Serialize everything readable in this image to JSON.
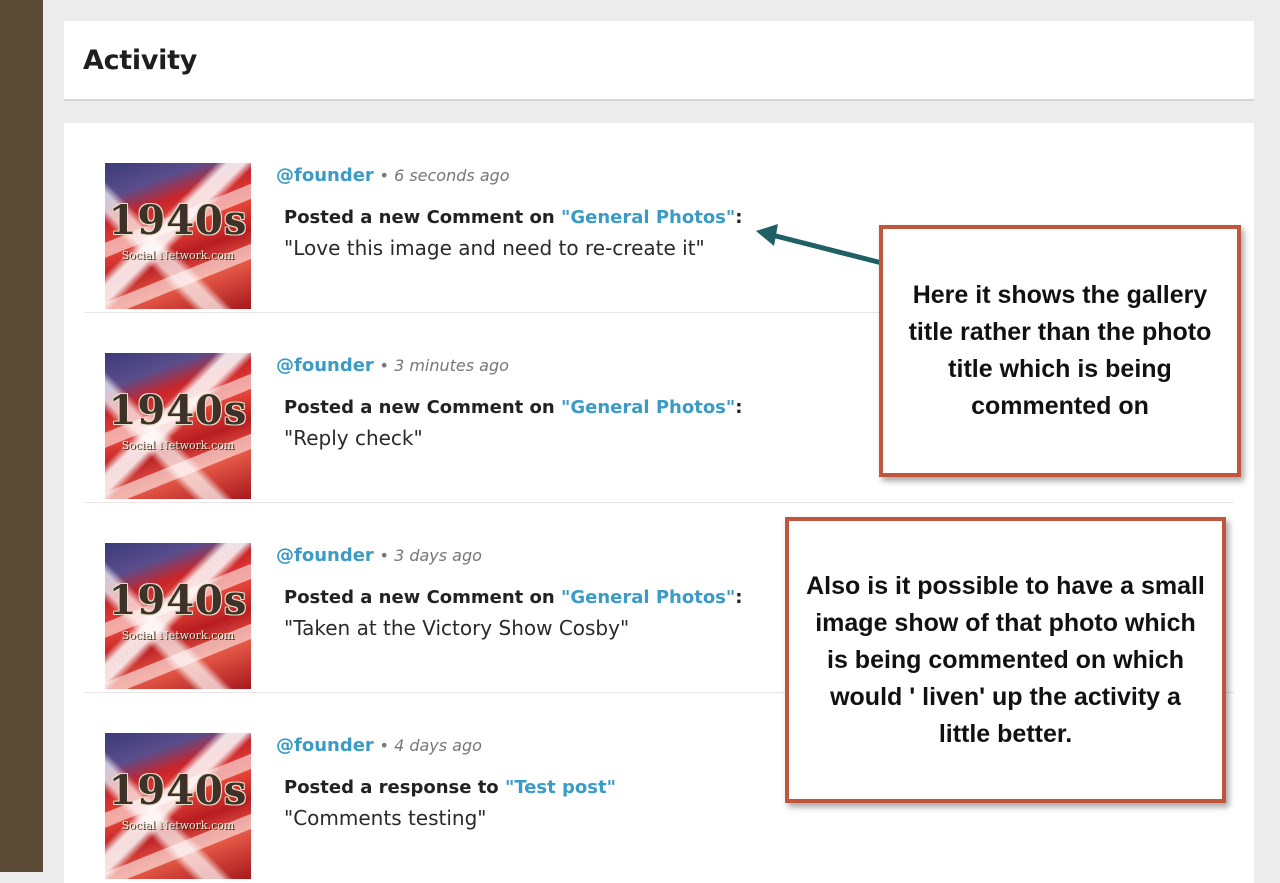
{
  "header": {
    "title": "Activity"
  },
  "avatar": {
    "line1": "1940s",
    "line2": "Social Network.com"
  },
  "activities": [
    {
      "username": "@founder",
      "time": "6 seconds ago",
      "action_prefix": "Posted a new Comment on ",
      "link_text": "\"General Photos\"",
      "action_suffix": ":",
      "comment": "\"Love this image and need to re-create it\""
    },
    {
      "username": "@founder",
      "time": "3 minutes ago",
      "action_prefix": "Posted a new Comment on ",
      "link_text": "\"General Photos\"",
      "action_suffix": ":",
      "comment": "\"Reply check\""
    },
    {
      "username": "@founder",
      "time": "3 days ago",
      "action_prefix": "Posted a new Comment on ",
      "link_text": "\"General Photos\"",
      "action_suffix": ":",
      "comment": "\"Taken at the Victory Show Cosby\""
    },
    {
      "username": "@founder",
      "time": "4 days ago",
      "action_prefix": "Posted a response to ",
      "link_text": "\"Test post\"",
      "action_suffix": "",
      "comment": "\"Comments testing\""
    }
  ],
  "callouts": [
    {
      "text": "Here it shows the gallery title rather than the photo title which is being commented on"
    },
    {
      "text": "Also is it possible to have a small image show of that photo which is being commented on which would ' liven' up the activity a little better."
    }
  ],
  "colors": {
    "link": "#3a9bc6",
    "callout_border": "#c0563c",
    "arrow": "#1f5f66",
    "sidebar": "#5a4a36"
  }
}
